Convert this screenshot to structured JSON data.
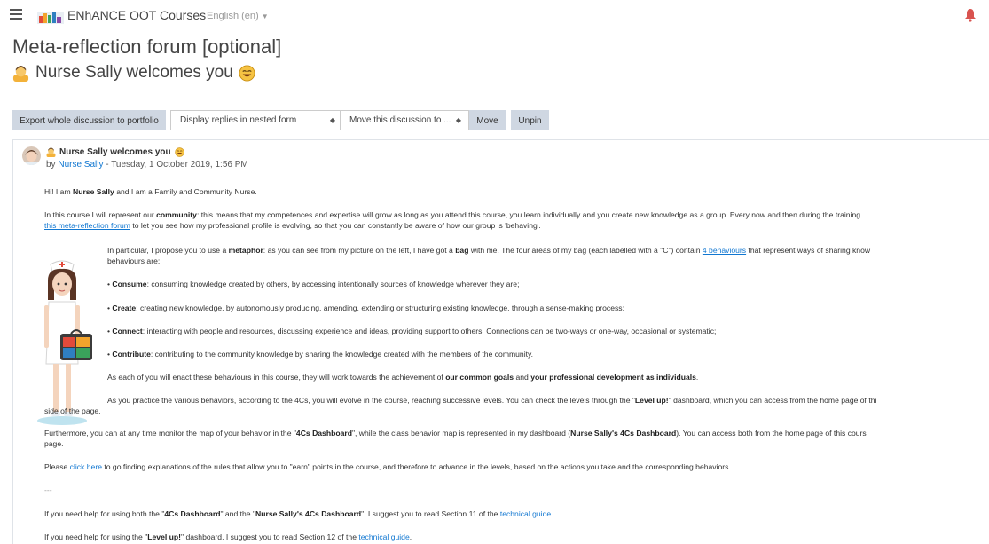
{
  "navbar": {
    "site_name": "ENhANCE OOT Courses",
    "language": "English (en)",
    "icons": [
      "hamburger-icon",
      "enhance-logo",
      "notification-bell-icon",
      "caret-down-icon"
    ]
  },
  "page_title": "Meta-reflection forum [optional]",
  "discussion_title": "Nurse Sally welcomes you",
  "toolbar": {
    "export_label": "Export whole discussion to portfolio",
    "display_mode": "Display replies in nested form",
    "move_select": "Move this discussion to ...",
    "move_label": "Move",
    "unpin_label": "Unpin"
  },
  "post": {
    "subject": "Nurse Sally welcomes you",
    "by": "by",
    "author": "Nurse Sally",
    "date": " - Tuesday, 1 October 2019, 1:56 PM",
    "p1": {
      "a": "Hi! I am ",
      "b": "Nurse Sally",
      "c": " and I am a Family and Community Nurse."
    },
    "p2": {
      "a": "In this course I will represent our ",
      "b": "community",
      "c": ": this means that my competences and expertise will grow as long as you attend this course, you learn individually and you create new knowledge as a group. Every now and then during the training"
    },
    "p2b": {
      "link": "this meta-reflection forum",
      "c": " to let you see how my professional profile is evolving, so that you can constantly be aware of how our group is 'behaving'."
    },
    "p3": {
      "a": "In particular, I propose you to use a ",
      "b": "metaphor",
      "c": ": as you can see from my picture on the left, I have got a ",
      "d": "bag",
      "e": " with me. The four areas of my bag (each labelled with a \"C\") contain ",
      "f": "4 behaviours",
      "g": " that represent ways of sharing know"
    },
    "p3b": "behaviours are:",
    "bullets": [
      {
        "term": "Consume",
        "text": ": consuming knowledge created by others, by accessing intentionally sources of knowledge wherever they are;"
      },
      {
        "term": "Create",
        "text": ": creating new knowledge, by autonomously producing, amending, extending or structuring existing knowledge, through a sense-making process;"
      },
      {
        "term": "Connect",
        "text": ": interacting with people and resources, discussing experience and ideas, providing support to others. Connections can be two-ways or one-way, occasional or systematic;"
      },
      {
        "term": "Contribute",
        "text": ": contributing to the community knowledge by sharing the knowledge created with the members of the community."
      }
    ],
    "bullet_mark": "• ",
    "p4": {
      "a": "As each of you will enact these behaviours in this course, they will work towards the achievement of ",
      "b": "our common goals",
      "c": " and ",
      "d": "your professional development as individuals",
      "e": "."
    },
    "p5": {
      "a": "As you practice the various behaviors, according to the 4Cs, you will evolve in the course, reaching successive levels. You can check the levels through the \"",
      "b": "Level up!",
      "c": "\" dashboard, which you can access from the home page of thi"
    },
    "p5b": "side of the page.",
    "p6": {
      "a": "Furthermore, you can at any time monitor the map of your behavior in the \"",
      "b": "4Cs Dashboard",
      "c": "\", while the class behavior map is represented in my dashboard (",
      "d": "Nurse Sally's 4Cs Dashboard",
      "e": "). You can access both from the home page of this cours"
    },
    "p6b": "page.",
    "p7": {
      "a": "Please ",
      "link": "click here",
      "c": " to go finding explanations of the rules that allow you to \"earn\" points in the course, and therefore to advance in the levels, based on the actions you take and the corresponding behaviors."
    },
    "separator": "---",
    "p8": {
      "a": "If you need help for using both the \"",
      "b": "4Cs Dashboard",
      "c": "\" and the \"",
      "d": "Nurse Sally's 4Cs Dashboard",
      "e": "\", I suggest you to read Section 11 of the ",
      "link": "technical guide",
      "f": "."
    },
    "p9": {
      "a": "If you need help for using the \"",
      "b": "Level up!",
      "c": "\" dashboard, I suggest you to read Section 12 of the ",
      "link": "technical guide",
      "f": "."
    }
  },
  "colors": {
    "link": "#1177d1",
    "button_bg": "#cfd7e2",
    "text": "#333333"
  }
}
